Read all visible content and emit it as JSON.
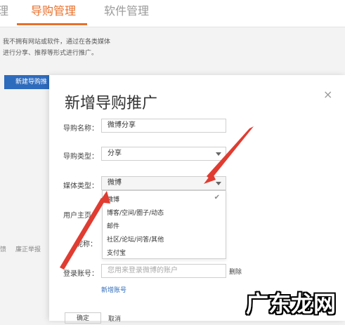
{
  "background": {
    "tabs": [
      {
        "label": "理"
      },
      {
        "label": "导购管理"
      },
      {
        "label": "软件管理"
      }
    ],
    "intro_lines": [
      "我不拥有网站或软件，通过在各类媒体",
      "进行分享、推荐等形式进行推广。"
    ],
    "new_button": "新建导购推",
    "footer_links": [
      "馈",
      "廉正举报"
    ]
  },
  "modal": {
    "title": "新增导购推广",
    "close": "×",
    "fields": {
      "name_label": "导购名称：",
      "name_value": "微博分享",
      "type_label": "导购类型：",
      "type_value": "分享",
      "media_label": "媒体类型：",
      "media_value": "微博",
      "user_home_label": "用户主页",
      "nickname_label": "昵称：",
      "account_label": "登录账号：",
      "account_placeholder": "您用来登录微博的账户",
      "delete": "删除",
      "add_account": "新增账号"
    },
    "dropdown_options": [
      "微博",
      "博客/空间/圈子/动态",
      "邮件",
      "社区/论坛/问答/其他",
      "支付宝"
    ],
    "bottom_buttons": [
      "确定",
      "取消"
    ]
  },
  "watermark": "广东龙网",
  "colors": {
    "accent": "#e8702a",
    "primary": "#2d6bbd",
    "arrow": "#e03c31"
  }
}
